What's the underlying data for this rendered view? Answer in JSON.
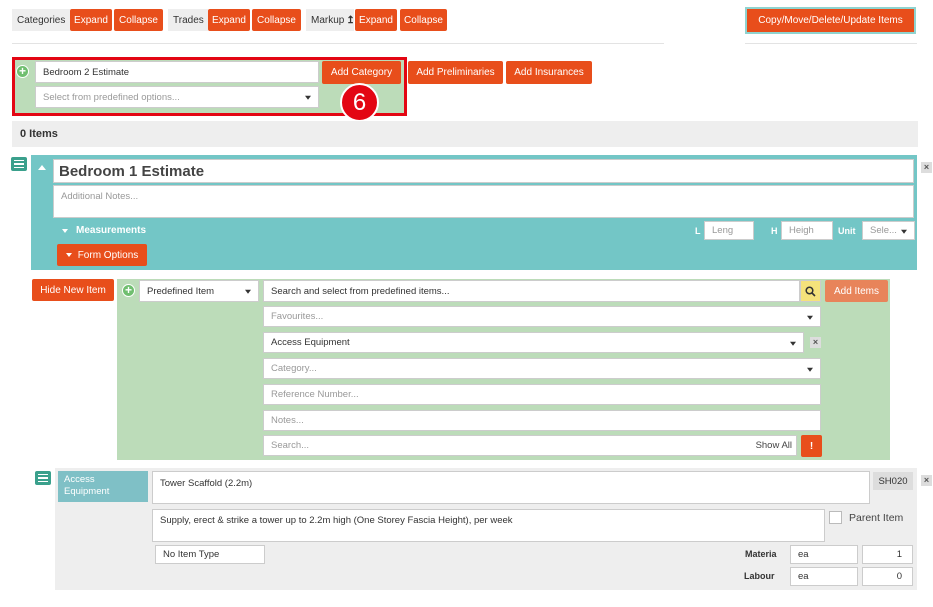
{
  "toolbar": {
    "categories_label": "Categories",
    "trades_label": "Trades",
    "markup_label": "Markup",
    "markup_arrow": "↥",
    "expand": "Expand",
    "collapse": "Collapse",
    "copy_move": "Copy/Move/Delete/Update Items"
  },
  "add_category": {
    "name_value": "Bedroom 2 Estimate",
    "predefined_placeholder": "Select from predefined options...",
    "add_category_label": "Add Category",
    "add_preliminaries_label": "Add Preliminaries",
    "add_insurances_label": "Add Insurances",
    "step_badge": "6"
  },
  "items_count": "0 Items",
  "category": {
    "title": "Bedroom 1 Estimate",
    "notes_placeholder": "Additional Notes...",
    "measurements_label": "Measurements",
    "l_label": "L",
    "l_placeholder": "Leng",
    "h_label": "H",
    "h_placeholder": "Heigh",
    "unit_label": "Unit",
    "unit_value": "Sele...",
    "form_options_label": "Form Options"
  },
  "new_item": {
    "hide_label": "Hide New Item",
    "type_value": "Predefined Item",
    "search_placeholder": "Search and select from predefined items...",
    "add_items_label": "Add Items",
    "favourites_placeholder": "Favourites...",
    "trade_value": "Access Equipment",
    "category_placeholder": "Category...",
    "reference_placeholder": "Reference Number...",
    "notes_placeholder": "Notes...",
    "search_small_placeholder": "Search...",
    "show_all_label": "Show All",
    "more_label": "!"
  },
  "item": {
    "trade_tag": "Access Equipment",
    "name": "Tower Scaffold (2.2m)",
    "code": "SH020",
    "description": "Supply, erect & strike a tower up to 2.2m high (One Storey Fascia Height), per week",
    "parent_label": "Parent Item",
    "item_type": "No Item Type",
    "material_label": "Materia",
    "material_unit": "ea",
    "material_qty": "1",
    "labour_label": "Labour",
    "labour_unit": "ea",
    "labour_qty": "0"
  },
  "colors": {
    "accent_orange": "#e84e1b",
    "teal": "#73c6c6",
    "light_green": "#bcdcb9",
    "highlight_red": "#e30613"
  }
}
